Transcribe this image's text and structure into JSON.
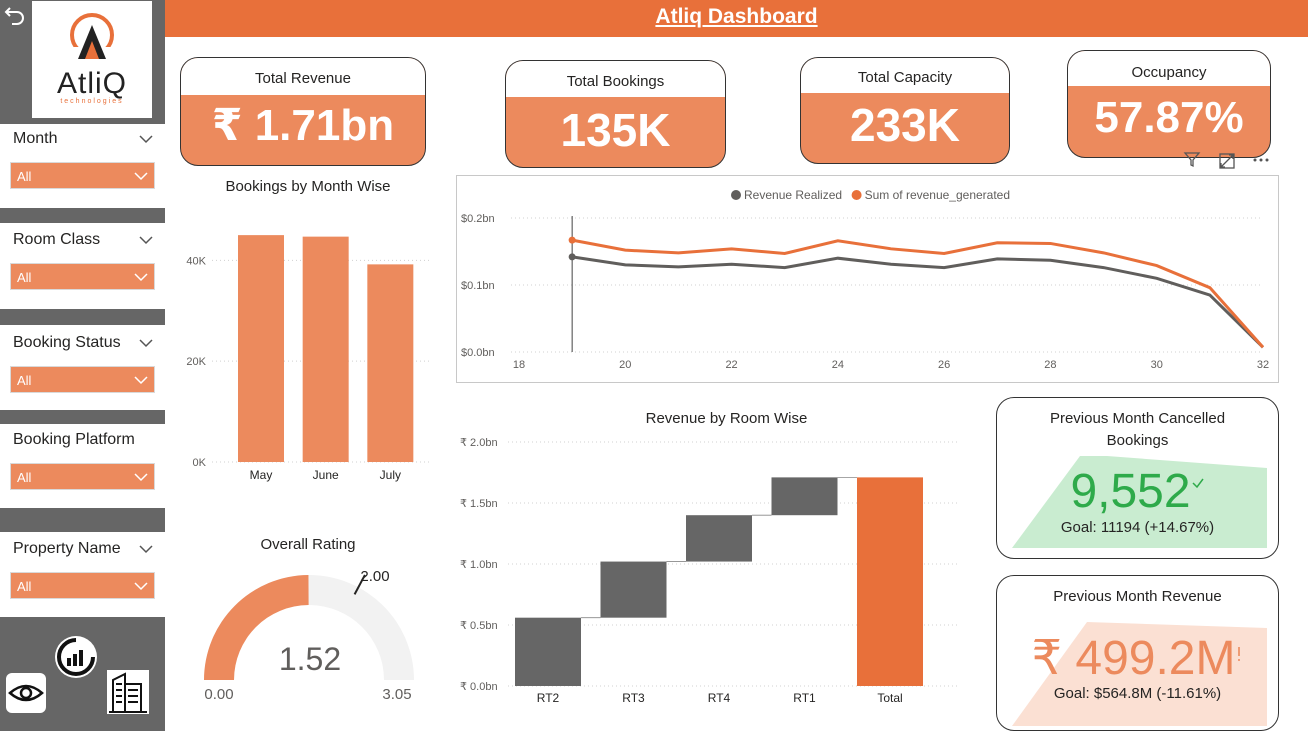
{
  "header": {
    "title": "Atliq Dashboard"
  },
  "logo": {
    "name": "AtliQ",
    "tagline": "technologies"
  },
  "slicers": [
    {
      "label": "Month",
      "value": "All"
    },
    {
      "label": "Room Class",
      "value": "All"
    },
    {
      "label": "Booking Status",
      "value": "All"
    },
    {
      "label": "Booking Platform",
      "value": "All"
    },
    {
      "label": "Property Name",
      "value": "All"
    }
  ],
  "kpis": {
    "total_revenue": {
      "label": "Total Revenue",
      "value": "₹ 1.71bn"
    },
    "total_bookings": {
      "label": "Total Bookings",
      "value": "135K"
    },
    "total_capacity": {
      "label": "Total Capacity",
      "value": "233K"
    },
    "occupancy": {
      "label": "Occupancy",
      "value": "57.87%"
    }
  },
  "bookings_chart": {
    "title": "Bookings by Month Wise"
  },
  "rating_chart": {
    "title": "Overall Rating",
    "value": "1.52",
    "min": "0.00",
    "max": "3.05",
    "target": "2.00"
  },
  "line_chart": {},
  "waterfall_chart": {
    "title": "Revenue by Room Wise"
  },
  "cancel_card": {
    "title_line1": "Previous Month Cancelled",
    "title_line2": "Bookings",
    "value": "9,552",
    "goal": "Goal: 11194 (+14.67%)"
  },
  "revenue_card": {
    "title": "Previous Month Revenue",
    "value": "₹ 499.2M",
    "goal": "Goal: $564.8M (-11.61%)"
  },
  "colors": {
    "accent": "#e8703a",
    "card": "#ec8a5d",
    "gray": "#666666",
    "green": "#2eaa4a",
    "light_green": "#c9ecd0",
    "light_peach": "#fbe0d3"
  },
  "chart_data": [
    {
      "type": "bar",
      "title": "Bookings by Month Wise",
      "categories": [
        "May",
        "June",
        "July"
      ],
      "values": [
        45000,
        44700,
        39200
      ],
      "yticks": [
        "0K",
        "20K",
        "40K"
      ],
      "ylim": [
        0,
        48000
      ]
    },
    {
      "type": "line",
      "x": [
        19,
        20,
        21,
        22,
        23,
        24,
        25,
        26,
        27,
        28,
        29,
        30,
        31,
        32
      ],
      "xticks": [
        "18",
        "20",
        "22",
        "24",
        "26",
        "28",
        "30",
        "32"
      ],
      "yticks": [
        "$0.0bn",
        "$0.1bn",
        "$0.2bn"
      ],
      "xlim": [
        18,
        32
      ],
      "ylim": [
        0,
        0.2
      ],
      "legend": "top-center",
      "series": [
        {
          "name": "Revenue Realized",
          "color": "#605e5c",
          "values": [
            0.142,
            0.13,
            0.127,
            0.131,
            0.126,
            0.14,
            0.131,
            0.126,
            0.139,
            0.137,
            0.126,
            0.11,
            0.085,
            0.007
          ]
        },
        {
          "name": "Sum of revenue_generated",
          "color": "#e8703a",
          "values": [
            0.167,
            0.152,
            0.148,
            0.154,
            0.147,
            0.166,
            0.154,
            0.147,
            0.163,
            0.162,
            0.148,
            0.129,
            0.096,
            0.007
          ]
        }
      ]
    },
    {
      "type": "bar",
      "subtype": "waterfall",
      "title": "Revenue by Room Wise",
      "categories": [
        "RT2",
        "RT3",
        "RT4",
        "RT1",
        "Total"
      ],
      "values": [
        0.56,
        0.46,
        0.38,
        0.31,
        1.71
      ],
      "yticks": [
        "₹ 0.0bn",
        "₹ 0.5bn",
        "₹ 1.0bn",
        "₹ 1.5bn",
        "₹ 2.0bn"
      ],
      "ylim": [
        0,
        2.0
      ]
    },
    {
      "type": "gauge",
      "title": "Overall Rating",
      "value": 1.52,
      "min": 0,
      "max": 3.05,
      "target": 2.0
    }
  ]
}
